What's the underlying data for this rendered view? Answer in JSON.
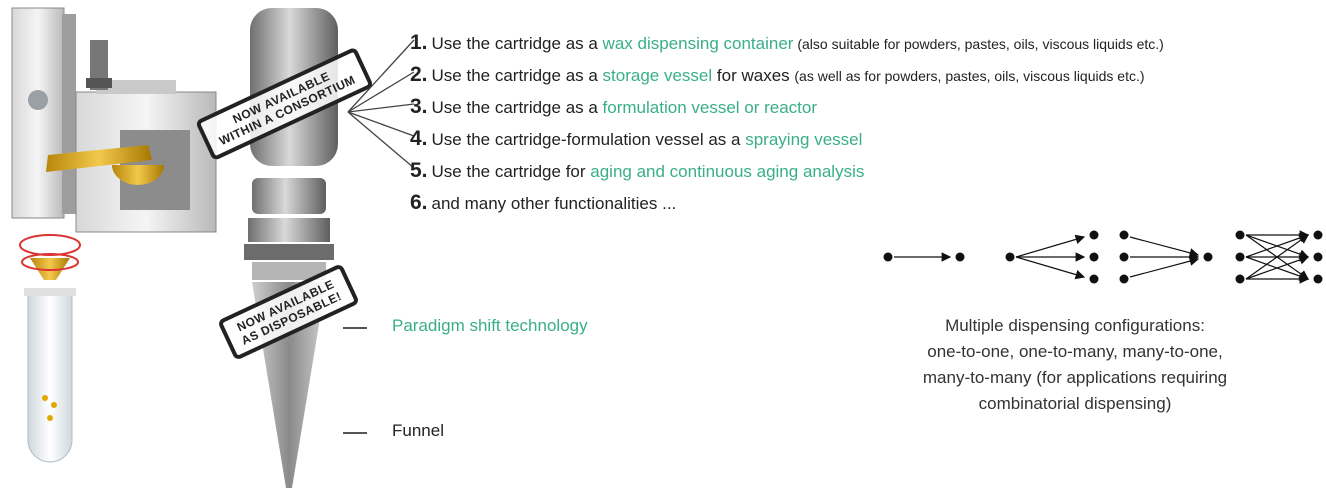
{
  "items": [
    {
      "num": "1.",
      "pre": "Use the cartridge as a ",
      "link": "wax dispensing container",
      "post": " (also suitable for powders, pastes, oils, viscous liquids etc.)",
      "post_small": true
    },
    {
      "num": "2.",
      "pre": "Use the cartridge as a ",
      "link": "storage vessel",
      "post": " for waxes ",
      "post2": "(as well as for powders, pastes, oils, viscous liquids etc.)"
    },
    {
      "num": "3.",
      "pre": "Use the cartridge as a ",
      "link": "formulation vessel or reactor",
      "post": ""
    },
    {
      "num": "4.",
      "pre": "Use the cartridge-formulation vessel as a ",
      "link": "spraying vessel",
      "post": ""
    },
    {
      "num": "5.",
      "pre": "Use the cartridge for ",
      "link": "aging and continuous aging analysis",
      "post": ""
    },
    {
      "num": "6.",
      "pre": "and many other functionalities ...",
      "link": "",
      "post": ""
    }
  ],
  "stamps": {
    "consortium_line1": "NOW AVAILABLE",
    "consortium_line2": "WITHIN A CONSORTIUM",
    "disposable_line1": "NOW AVAILABLE",
    "disposable_line2": "AS DISPOSABLE!"
  },
  "labels": {
    "paradigm": "Paradigm shift technology",
    "funnel": "Funnel"
  },
  "caption": {
    "line1": "Multiple dispensing configurations:",
    "line2": "one-to-one, one-to-many, many-to-one,",
    "line3": "many-to-many (for applications requiring",
    "line4": "combinatorial dispensing)"
  },
  "colors": {
    "accent_green": "#3aae8a",
    "gold": "#e0b020",
    "metal": "#8a8a8a"
  }
}
